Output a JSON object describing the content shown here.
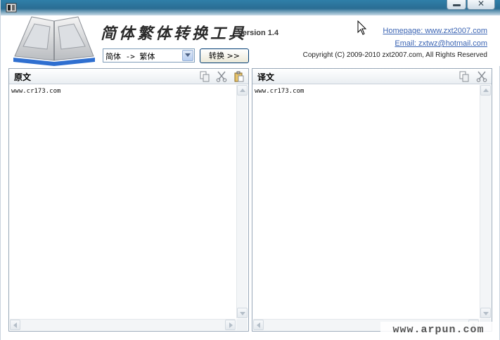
{
  "window": {
    "icon": "app-icon",
    "controls": {
      "minimize_icon": "minimize-icon",
      "close_icon": "close-icon"
    }
  },
  "header": {
    "title": "简体繁体转换工具",
    "version": "Version 1.4",
    "mode_select": {
      "selected": "简体 -> 繁体"
    },
    "convert_label": "转换 >>",
    "homepage_link": "Homepage: www.zxt2007.com",
    "email_link": "Email: zxtwz@hotmail.com",
    "copyright": "Copyright (C) 2009-2010 zxt2007.com, All Rights Reserved"
  },
  "source_panel": {
    "title": "原文",
    "content": "www.cr173.com",
    "tools": [
      "copy-icon",
      "cut-icon",
      "paste-icon"
    ]
  },
  "target_panel": {
    "title": "译文",
    "content": "www.cr173.com",
    "tools": [
      "copy-icon",
      "cut-icon"
    ]
  },
  "watermark": "www.arpun.com",
  "colors": {
    "titlebar": "#2a6d93",
    "link": "#3b64b3",
    "panel_border": "#99a8b8"
  }
}
